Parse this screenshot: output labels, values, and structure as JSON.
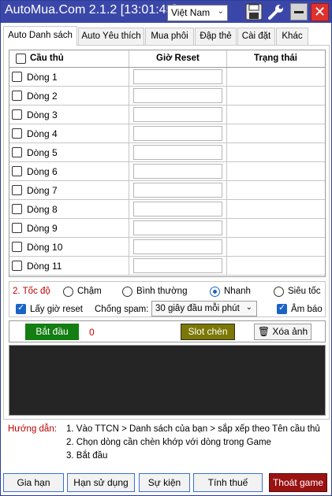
{
  "window": {
    "title": "AutoMua.Com 2.1.2 [13:01:45]",
    "language": "Việt Nam"
  },
  "tabs": [
    {
      "label": "Auto Danh sách",
      "active": true
    },
    {
      "label": "Auto Yêu thích",
      "active": false
    },
    {
      "label": "Mua phôi",
      "active": false
    },
    {
      "label": "Đập thẻ",
      "active": false
    },
    {
      "label": "Cài đặt",
      "active": false
    },
    {
      "label": "Khác",
      "active": false
    }
  ],
  "grid": {
    "headers": {
      "player": "Cầu thủ",
      "reset_time": "Giờ Reset",
      "status": "Trạng thái"
    },
    "rows": [
      "Dòng 1",
      "Dòng 2",
      "Dòng 3",
      "Dòng 4",
      "Dòng 5",
      "Dòng 6",
      "Dòng 7",
      "Dòng 8",
      "Dòng 9",
      "Dòng 10",
      "Dòng 11"
    ]
  },
  "speed": {
    "label": "2. Tốc độ",
    "options": [
      "Chậm",
      "Bình thường",
      "Nhanh",
      "Siêu tốc"
    ],
    "selected": "Nhanh"
  },
  "options": {
    "get_reset_time": "Lấy giờ reset",
    "get_reset_time_checked": true,
    "anti_spam_label": "Chống spam:",
    "anti_spam_value": "30 giây đầu mỗi phút",
    "sound": "Âm báo",
    "sound_checked": true
  },
  "actions": {
    "start": "Bắt đầu",
    "counter": "0",
    "slot": "Slot chèn",
    "clear_image": "Xóa ảnh"
  },
  "help": {
    "label": "Hướng dẫn:",
    "lines": [
      "1.  Vào TTCN > Danh sách của bạn > sắp xếp theo Tên cầu thủ",
      "2.  Chọn dòng cần chèn khớp với dòng trong Game",
      "3.  Bắt đầu"
    ]
  },
  "footer": {
    "buttons": [
      "Gia hạn",
      "Hạn sử dụng",
      "Sự kiện",
      "Tính thuế",
      "Thoát game"
    ]
  },
  "colors": {
    "titlebar": "#3b47a8",
    "start": "#137e12",
    "slot": "#7b7806",
    "exit": "#9a1212",
    "accent_red": "#c00000"
  }
}
